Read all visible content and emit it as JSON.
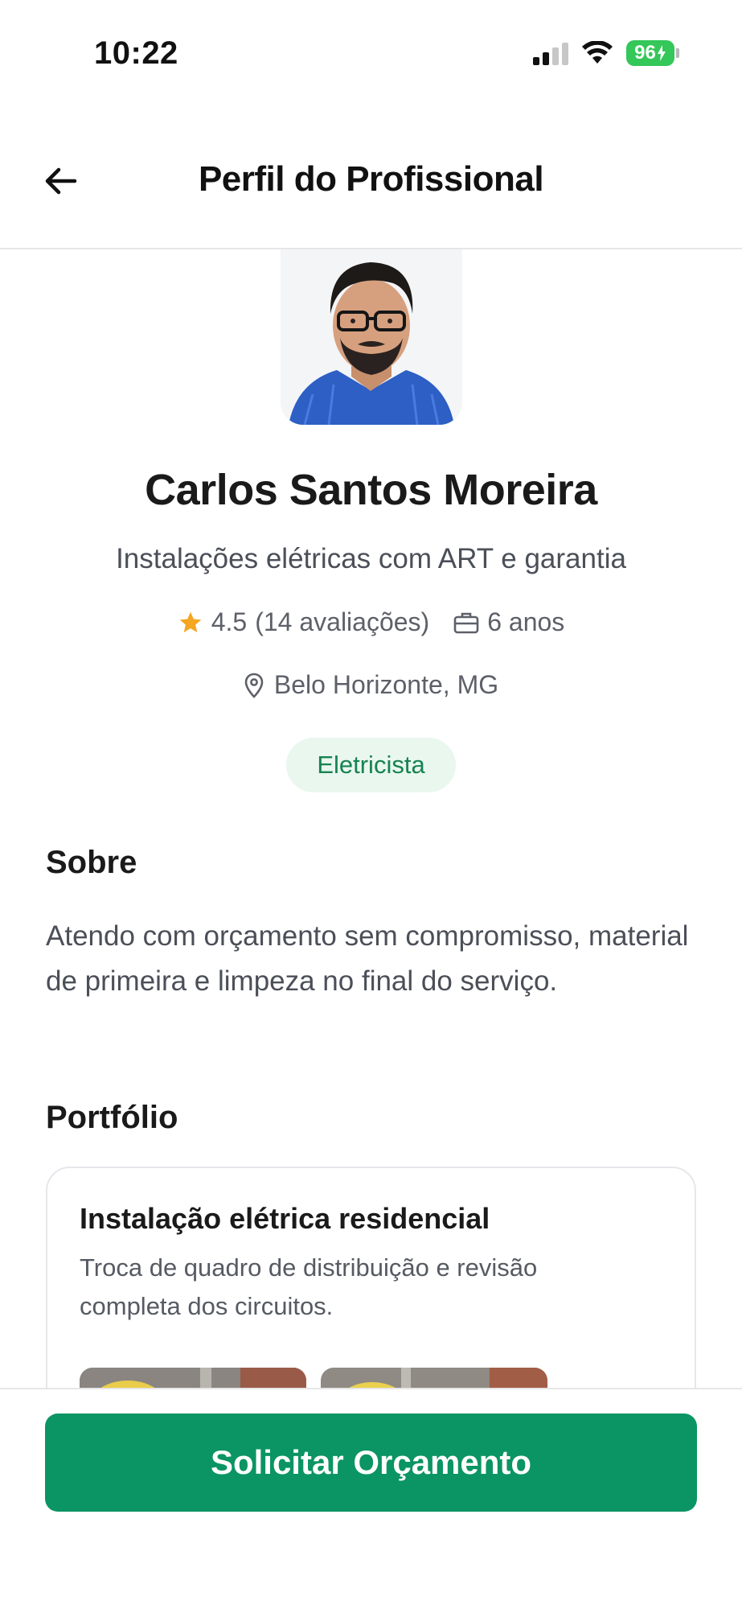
{
  "status_bar": {
    "time": "10:22",
    "battery": "96",
    "icons": [
      "signal-icon",
      "wifi-icon",
      "battery-charging-icon"
    ]
  },
  "header": {
    "title": "Perfil do Profissional",
    "back_icon": "arrow-left-icon"
  },
  "profile": {
    "name": "Carlos Santos Moreira",
    "tagline": "Instalações elétricas com ART e garantia",
    "rating": "4.5",
    "reviews": "(14 avaliações)",
    "experience": "6 anos",
    "location": "Belo Horizonte, MG",
    "category": "Eletricista"
  },
  "about": {
    "title": "Sobre",
    "text": "Atendo com orçamento sem compromisso, material de primeira e limpeza no final do serviço."
  },
  "portfolio": {
    "title": "Portfólio",
    "items": [
      {
        "title": "Instalação elétrica residencial",
        "description": "Troca de quadro de distribuição e revisão completa dos circuitos."
      }
    ]
  },
  "cta": {
    "label": "Solicitar Orçamento"
  },
  "colors": {
    "accent": "#0b9464",
    "chip_bg": "#e9f7ef",
    "chip_text": "#17834f",
    "star": "#f5a623",
    "battery": "#34c759"
  }
}
